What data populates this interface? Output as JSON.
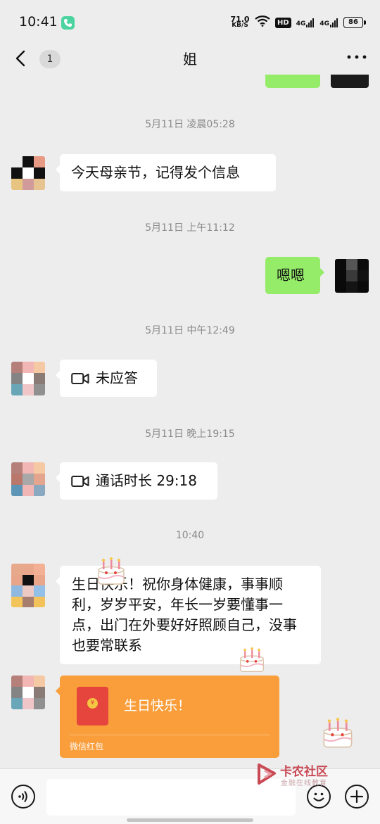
{
  "status_bar": {
    "time": "10:41",
    "net_speed_value": "71.0",
    "net_speed_unit": "KB/S",
    "hd_label": "HD",
    "signal_1": "4G",
    "signal_2": "4G",
    "battery": "86"
  },
  "header": {
    "back_badge": "1",
    "title": "姐",
    "more_label": "···"
  },
  "messages": {
    "ts_1": "5月11日 凌晨05:28",
    "msg_1": "今天母亲节，记得发个信息",
    "ts_2": "5月11日 上午11:12",
    "msg_2": "嗯嗯",
    "ts_3": "5月11日 中午12:49",
    "msg_3": "未应答",
    "ts_4": "5月11日 晚上19:15",
    "msg_4": "通话时长 29:18",
    "ts_5": "10:40",
    "msg_5": "生日快乐！祝你身体健康，事事顺利，岁岁平安，年长一岁要懂事一点，出门在外要好好照顾自己，没事也要常联系",
    "red_packet_text": "生日快乐！",
    "red_packet_footer": "微信红包",
    "red_packet_coin": "¥"
  },
  "watermark": {
    "name": "卡农社区",
    "sub": "金融在线教育"
  },
  "colors": {
    "background": "#ededed",
    "my_bubble": "#95ec69",
    "red_packet": "#f99e3b",
    "watermark": "#c94a55"
  }
}
